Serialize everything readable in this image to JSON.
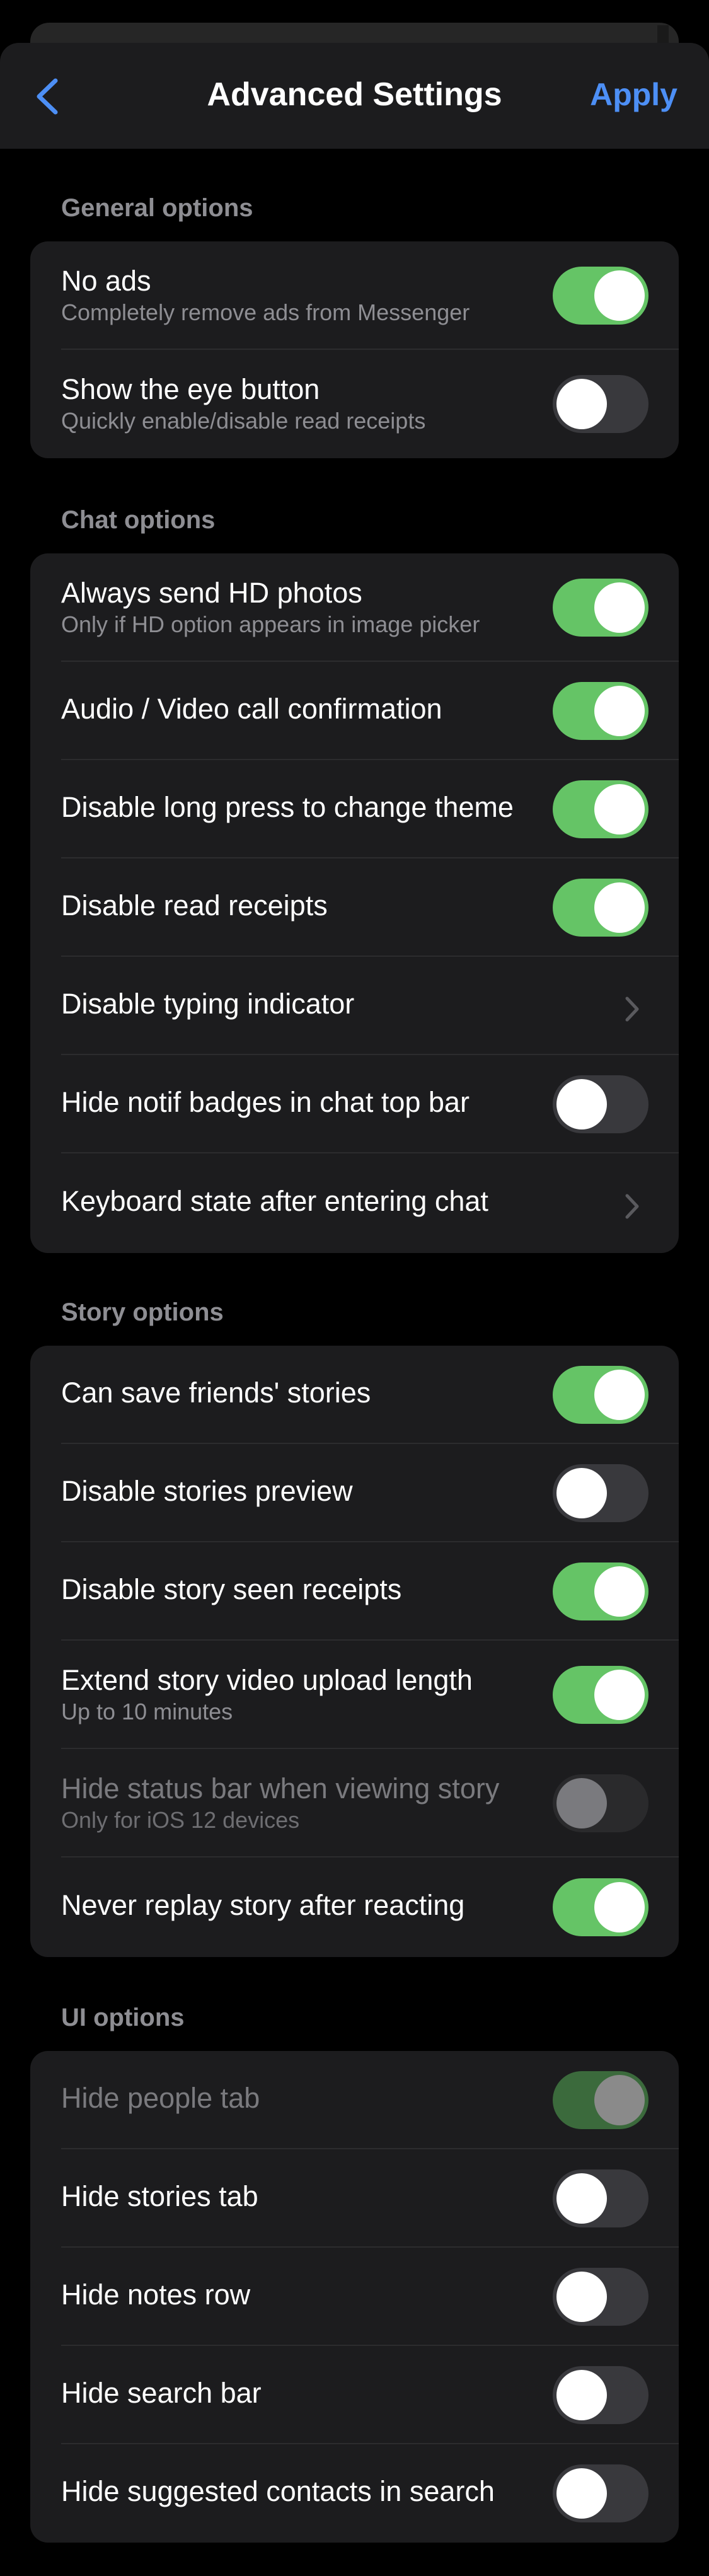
{
  "nav": {
    "title": "Advanced Settings",
    "apply_label": "Apply",
    "back_icon": "chevron-left-icon",
    "accent_color": "#4d8ff5"
  },
  "sections": [
    {
      "header": "General options",
      "rows": [
        {
          "label": "No ads",
          "sublabel": "Completely remove ads from Messenger",
          "control": "toggle",
          "on": true,
          "disabled": false
        },
        {
          "label": "Show the eye button",
          "sublabel": "Quickly enable/disable read receipts",
          "control": "toggle",
          "on": false,
          "disabled": false
        }
      ]
    },
    {
      "header": "Chat options",
      "rows": [
        {
          "label": "Always send HD photos",
          "sublabel": "Only if HD option appears in image picker",
          "control": "toggle",
          "on": true,
          "disabled": false
        },
        {
          "label": "Audio / Video call confirmation",
          "control": "toggle",
          "on": true,
          "disabled": false
        },
        {
          "label": "Disable long press to change theme",
          "control": "toggle",
          "on": true,
          "disabled": false
        },
        {
          "label": "Disable read receipts",
          "control": "toggle",
          "on": true,
          "disabled": false
        },
        {
          "label": "Disable typing indicator",
          "control": "chevron"
        },
        {
          "label": "Hide notif badges in chat top bar",
          "control": "toggle",
          "on": false,
          "disabled": false
        },
        {
          "label": "Keyboard state after entering chat",
          "control": "chevron"
        }
      ]
    },
    {
      "header": "Story options",
      "rows": [
        {
          "label": "Can save friends' stories",
          "control": "toggle",
          "on": true,
          "disabled": false
        },
        {
          "label": "Disable stories preview",
          "control": "toggle",
          "on": false,
          "disabled": false
        },
        {
          "label": "Disable story seen receipts",
          "control": "toggle",
          "on": true,
          "disabled": false
        },
        {
          "label": "Extend story video upload length",
          "sublabel": "Up to 10 minutes",
          "control": "toggle",
          "on": true,
          "disabled": false
        },
        {
          "label": "Hide status bar when viewing story",
          "sublabel": "Only for iOS 12 devices",
          "control": "toggle",
          "on": false,
          "disabled": true
        },
        {
          "label": "Never replay story after reacting",
          "control": "toggle",
          "on": true,
          "disabled": false
        }
      ]
    },
    {
      "header": "UI options",
      "rows": [
        {
          "label": "Hide people tab",
          "control": "toggle",
          "on": true,
          "disabled": true
        },
        {
          "label": "Hide stories tab",
          "control": "toggle",
          "on": false,
          "disabled": false
        },
        {
          "label": "Hide notes row",
          "control": "toggle",
          "on": false,
          "disabled": false
        },
        {
          "label": "Hide search bar",
          "control": "toggle",
          "on": false,
          "disabled": false
        },
        {
          "label": "Hide suggested contacts in search",
          "control": "toggle",
          "on": false,
          "disabled": false
        }
      ]
    }
  ],
  "colors": {
    "background": "#000000",
    "group_background": "#1c1c1e",
    "toggle_on": "#65c466",
    "toggle_off": "#39393d",
    "secondary_text": "#8e8e93"
  }
}
